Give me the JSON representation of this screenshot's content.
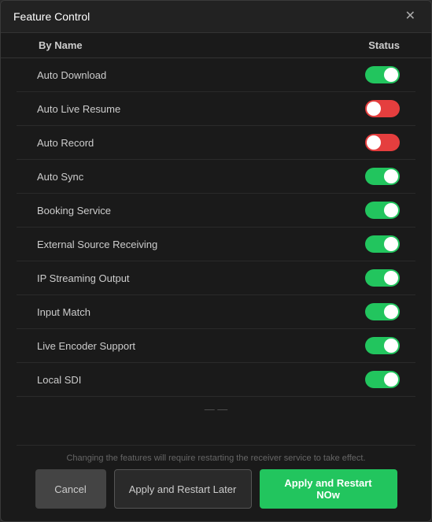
{
  "dialog": {
    "title": "Feature Control",
    "close_label": "✕"
  },
  "table": {
    "col_name": "By Name",
    "col_status": "Status"
  },
  "features": [
    {
      "name": "Auto Download",
      "enabled": true
    },
    {
      "name": "Auto Live Resume",
      "enabled": false
    },
    {
      "name": "Auto Record",
      "enabled": false
    },
    {
      "name": "Auto Sync",
      "enabled": true
    },
    {
      "name": "Booking Service",
      "enabled": true
    },
    {
      "name": "External Source Receiving",
      "enabled": true
    },
    {
      "name": "IP Streaming Output",
      "enabled": true
    },
    {
      "name": "Input Match",
      "enabled": true
    },
    {
      "name": "Live Encoder Support",
      "enabled": true
    },
    {
      "name": "Local SDI",
      "enabled": true
    }
  ],
  "more_indicator": "...",
  "footer": {
    "note": "Changing the features will require restarting the receiver service to take effect.",
    "cancel_label": "Cancel",
    "restart_later_label": "Apply and Restart Later",
    "restart_now_label": "Apply and Restart NOw"
  }
}
